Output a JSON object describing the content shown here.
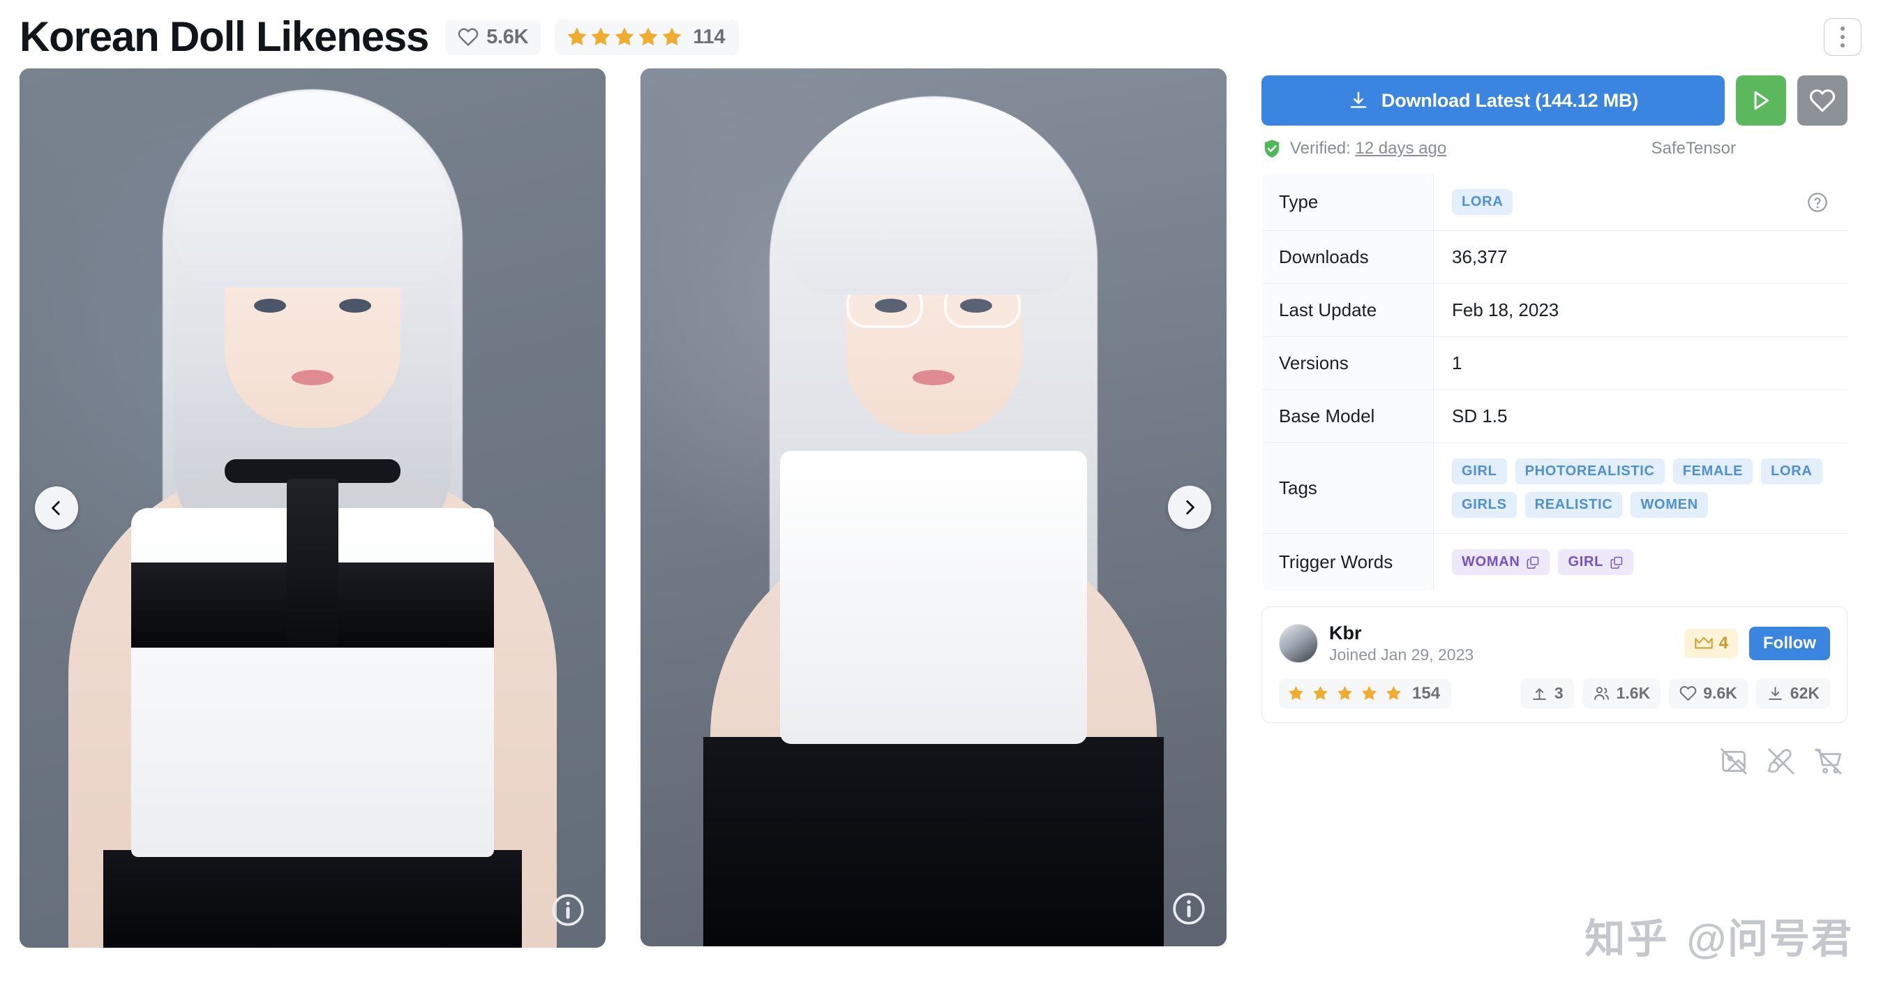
{
  "header": {
    "title": "Korean Doll Likeness",
    "likes": "5.6K",
    "rating_count": "114",
    "heart_icon": "heart-outline-icon",
    "star_icon": "star-filled-icon",
    "menu_icon": "more-vertical-icon"
  },
  "gallery": {
    "prev_icon": "chevron-left-icon",
    "next_icon": "chevron-right-icon",
    "info_icon": "info-circle-icon",
    "images": [
      {
        "alt": "Preview image 1 — white-haired woman in black and white top"
      },
      {
        "alt": "Preview image 2 — white-haired woman with glasses in white top"
      }
    ]
  },
  "actions": {
    "download_label": "Download Latest (144.12 MB)",
    "download_icon": "download-icon",
    "run_icon": "play-triangle-icon",
    "favorite_icon": "heart-outline-icon",
    "download_bg": "#3a85e0",
    "run_bg": "#5cb85c",
    "favorite_bg": "#8b9197"
  },
  "verification": {
    "shield_icon": "shield-check-icon",
    "prefix": "Verified:",
    "time": "12 days ago",
    "format": "SafeTensor",
    "shield_color": "#4eb85b"
  },
  "info_table": {
    "help_icon": "help-circle-icon",
    "rows": [
      {
        "key": "Type",
        "kind": "chips",
        "chips": [
          "LORA"
        ],
        "has_help": true
      },
      {
        "key": "Downloads",
        "kind": "text",
        "value": "36,377"
      },
      {
        "key": "Last Update",
        "kind": "text",
        "value": "Feb 18, 2023"
      },
      {
        "key": "Versions",
        "kind": "text",
        "value": "1"
      },
      {
        "key": "Base Model",
        "kind": "text",
        "value": "SD 1.5"
      },
      {
        "key": "Tags",
        "kind": "chips",
        "chips": [
          "GIRL",
          "PHOTOREALISTIC",
          "FEMALE",
          "LORA",
          "GIRLS",
          "REALISTIC",
          "WOMEN"
        ]
      },
      {
        "key": "Trigger Words",
        "kind": "trigger",
        "chips": [
          "WOMAN",
          "GIRL"
        ],
        "copy_icon": "copy-icon"
      }
    ]
  },
  "creator": {
    "name": "Kbr",
    "joined": "Joined Jan 29, 2023",
    "avatar_icon": "user-avatar",
    "crown_icon": "crown-icon",
    "crown_count": "4",
    "follow_label": "Follow",
    "rating_count": "154",
    "stats": [
      {
        "icon": "upload-icon",
        "value": "3"
      },
      {
        "icon": "users-icon",
        "value": "1.6K"
      },
      {
        "icon": "heart-icon",
        "value": "9.6K"
      },
      {
        "icon": "download-icon",
        "value": "62K"
      }
    ]
  },
  "permissions": [
    {
      "icon": "no-image-icon"
    },
    {
      "icon": "no-brush-icon"
    },
    {
      "icon": "no-cart-icon"
    }
  ],
  "watermark": {
    "site": "知乎",
    "handle": "@问号君"
  }
}
